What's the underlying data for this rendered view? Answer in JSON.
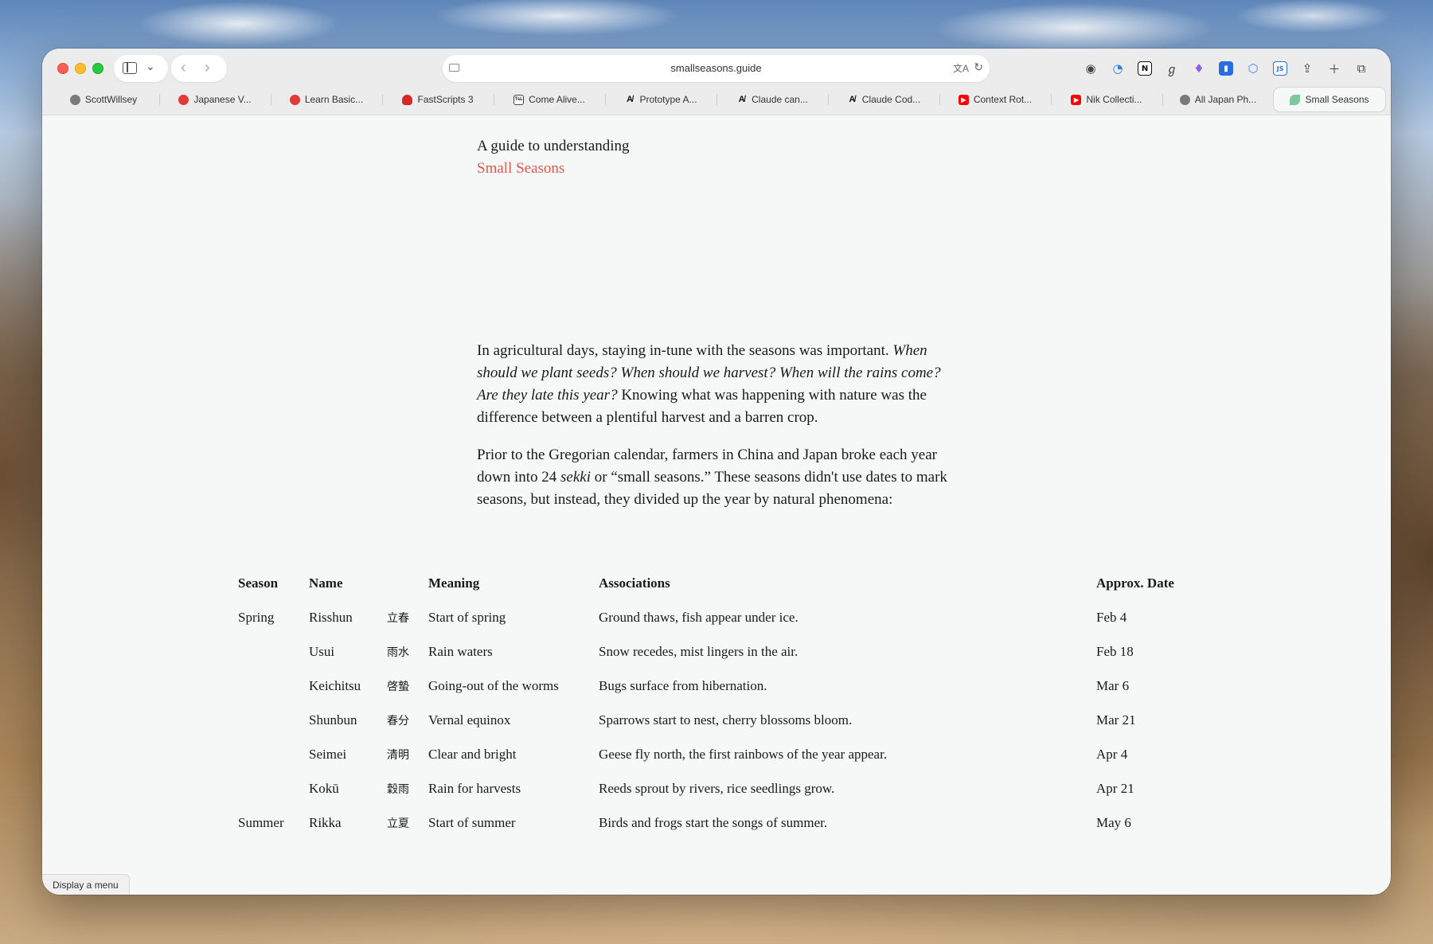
{
  "browser": {
    "address": "smallseasons.guide",
    "tabs": [
      {
        "label": "ScottWillsey",
        "favicon": "person-icon",
        "active": false
      },
      {
        "label": "Japanese V...",
        "favicon": "red-logo-icon",
        "active": false
      },
      {
        "label": "Learn Basic...",
        "favicon": "red-logo-icon",
        "active": false
      },
      {
        "label": "FastScripts 3",
        "favicon": "crab-icon",
        "active": false
      },
      {
        "label": "Come Alive...",
        "favicon": "tsl-icon",
        "active": false
      },
      {
        "label": "Prototype A...",
        "favicon": "anthropic-icon",
        "active": false
      },
      {
        "label": "Claude can...",
        "favicon": "anthropic-icon",
        "active": false
      },
      {
        "label": "Claude Cod...",
        "favicon": "anthropic-icon",
        "active": false
      },
      {
        "label": "Context Rot...",
        "favicon": "youtube-icon",
        "active": false
      },
      {
        "label": "Nik Collecti...",
        "favicon": "youtube-icon",
        "active": false
      },
      {
        "label": "All Japan Ph...",
        "favicon": "person-icon",
        "active": false
      },
      {
        "label": "Small Seasons",
        "favicon": "leaf-icon",
        "active": true
      }
    ]
  },
  "page": {
    "intro_line1": "A guide to understanding",
    "intro_line2": "Small Seasons",
    "accent_color": "#e0584d",
    "p1_a": "In agricultural days, staying in-tune with the seasons was important. ",
    "p1_em": "When should we plant seeds? When should we harvest? When will the rains come? Are they late this year?",
    "p1_b": " Knowing what was happening with nature was the difference between a plentiful harvest and a barren crop.",
    "p2_a": "Prior to the Gregorian calendar, farmers in China and Japan broke each year down into 24 ",
    "p2_em": "sekki",
    "p2_b": " or “small seasons.” These seasons didn't use dates to mark seasons, but instead, they divided up the year by natural phenomena:"
  },
  "table": {
    "headers": {
      "season": "Season",
      "name": "Name",
      "meaning": "Meaning",
      "associations": "Associations",
      "date": "Approx. Date"
    },
    "rows": [
      {
        "season": "Spring",
        "name": "Risshun",
        "kanji": "立春",
        "meaning": "Start of spring",
        "associations": "Ground thaws, fish appear under ice.",
        "date": "Feb 4"
      },
      {
        "season": "",
        "name": "Usui",
        "kanji": "雨水",
        "meaning": "Rain waters",
        "associations": "Snow recedes, mist lingers in the air.",
        "date": "Feb 18"
      },
      {
        "season": "",
        "name": "Keichitsu",
        "kanji": "啓蟄",
        "meaning": "Going-out of the worms",
        "associations": "Bugs surface from hibernation.",
        "date": "Mar 6"
      },
      {
        "season": "",
        "name": "Shunbun",
        "kanji": "春分",
        "meaning": "Vernal equinox",
        "associations": "Sparrows start to nest, cherry blossoms bloom.",
        "date": "Mar 21"
      },
      {
        "season": "",
        "name": "Seimei",
        "kanji": "清明",
        "meaning": "Clear and bright",
        "associations": "Geese fly north, the first rainbows of the year appear.",
        "date": "Apr 4"
      },
      {
        "season": "",
        "name": "Kokū",
        "kanji": "穀雨",
        "meaning": "Rain for harvests",
        "associations": "Reeds sprout by rivers, rice seedlings grow.",
        "date": "Apr 21"
      },
      {
        "season": "Summer",
        "name": "Rikka",
        "kanji": "立夏",
        "meaning": "Start of summer",
        "associations": "Birds and frogs start the songs of summer.",
        "date": "May 6"
      }
    ]
  },
  "status_tooltip": "Display a menu"
}
